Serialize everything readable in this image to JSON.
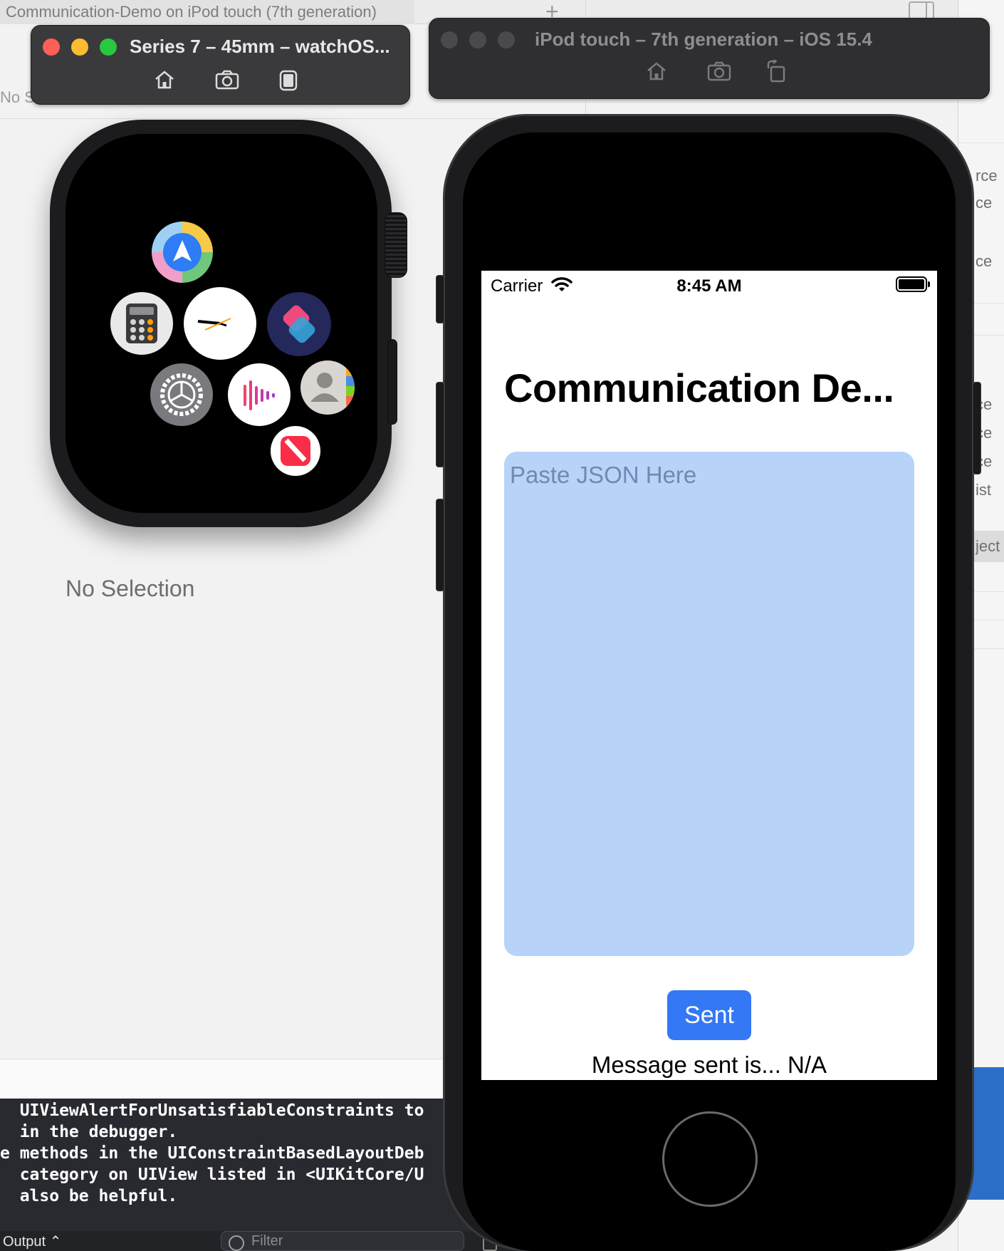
{
  "xcode": {
    "tab_title": "Communication-Demo on iPod touch (7th generation)",
    "no_selection_small": "No Se",
    "no_selection": "No Selection",
    "right_panel_items": [
      "rce",
      "ce",
      "ce",
      "ce",
      "ce",
      "ce",
      "ist",
      "ject"
    ],
    "console_lines": [
      "  UIViewAlertForUnsatisfiableConstraints to",
      "  in the debugger.",
      "e methods in the UIConstraintBasedLayoutDeb",
      "  category on UIView listed in <UIKitCore/U",
      "  also be helpful."
    ],
    "output_label": "Output ⌃",
    "filter_placeholder": "Filter"
  },
  "watch_sim": {
    "title": "Series 7 – 45mm – watchOS...",
    "icons": [
      "home-icon",
      "screenshot-icon",
      "rotate-icon"
    ],
    "apps": [
      "maps-app-icon",
      "calculator-app-icon",
      "clock-app-icon",
      "shortcuts-app-icon",
      "settings-app-icon",
      "voice-memos-app-icon",
      "contacts-app-icon",
      "news-app-icon"
    ]
  },
  "ipod_sim": {
    "title": "iPod touch – 7th generation – iOS 15.4",
    "icons": [
      "home-icon",
      "screenshot-icon",
      "rotate-icon"
    ]
  },
  "ipod_app": {
    "status_bar": {
      "carrier": "Carrier",
      "time": "8:45 AM"
    },
    "nav_title": "Communication De...",
    "json_placeholder": "Paste JSON Here",
    "json_value": "",
    "send_button": "Sent",
    "status_message": "Message sent is... N/A"
  },
  "colors": {
    "send_button": "#3478F6",
    "text_area": "#B8D3F8",
    "close": "#FF5F57",
    "minimize": "#FEBC2E",
    "zoom": "#28C840"
  }
}
